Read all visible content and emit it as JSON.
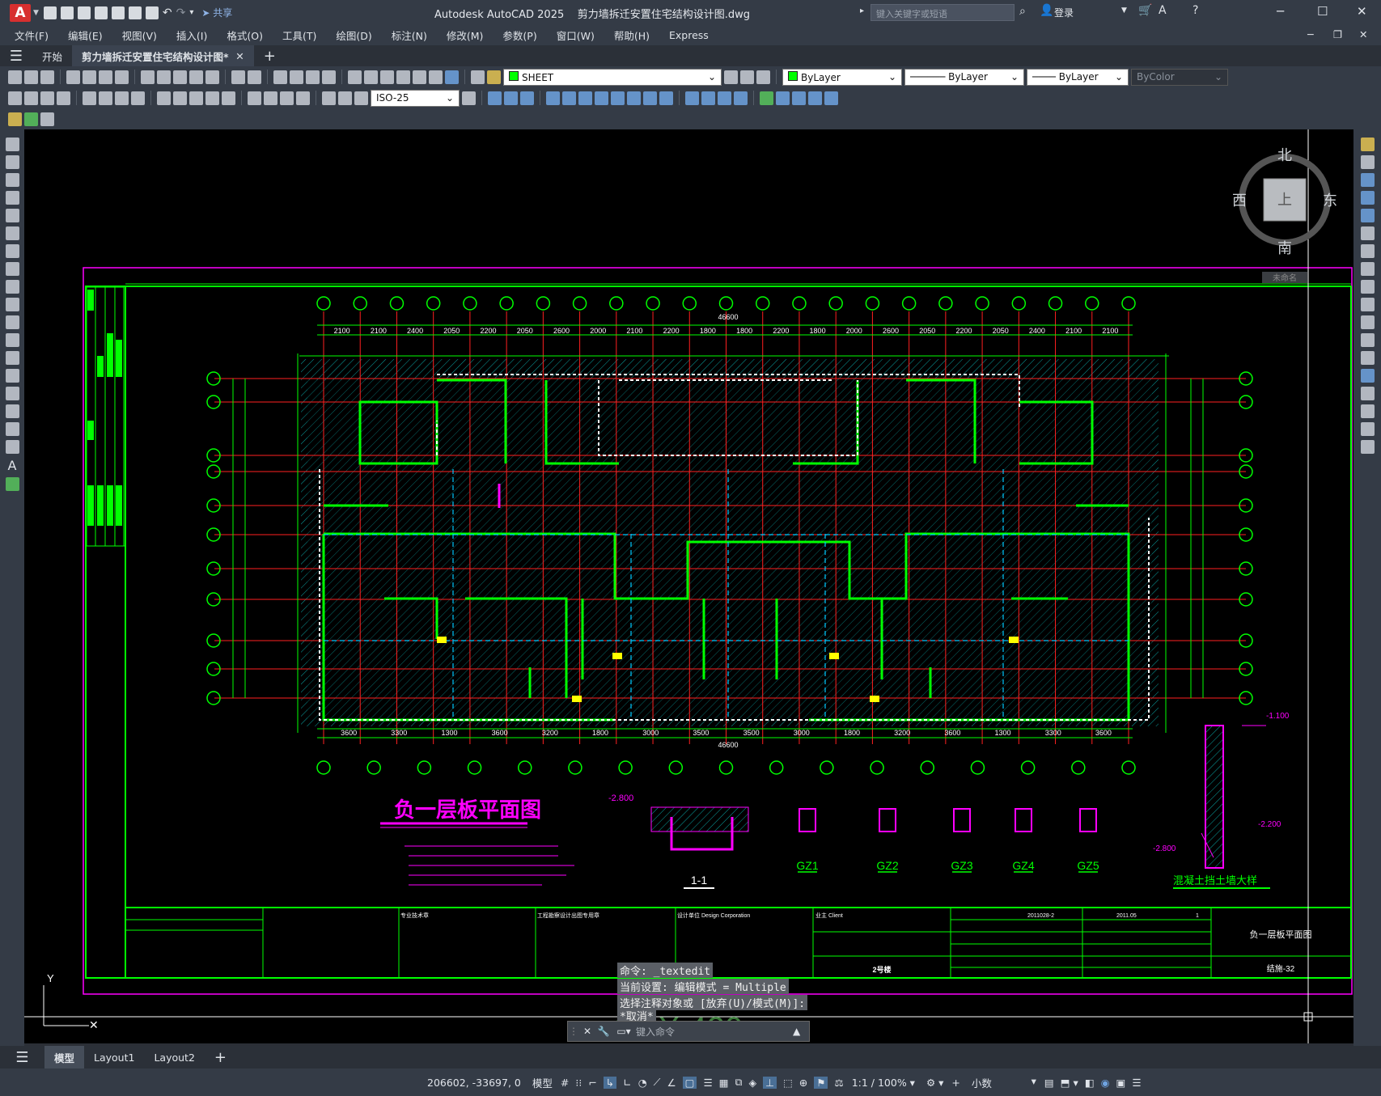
{
  "title": {
    "app": "Autodesk AutoCAD 2025",
    "file": "剪力墙拆迁安置住宅结构设计图.dwg",
    "share": "共享",
    "search_placeholder": "键入关键字或短语",
    "login": "登录",
    "app_badge": "A"
  },
  "menu": [
    "文件(F)",
    "编辑(E)",
    "视图(V)",
    "插入(I)",
    "格式(O)",
    "工具(T)",
    "绘图(D)",
    "标注(N)",
    "修改(M)",
    "参数(P)",
    "窗口(W)",
    "帮助(H)",
    "Express"
  ],
  "doc_tabs": {
    "start": "开始",
    "active": "剪力墙拆迁安置住宅结构设计图*"
  },
  "toolbar": {
    "layer": "SHEET",
    "color": "ByLayer",
    "linetype": "ByLayer",
    "lineweight": "ByLayer",
    "plotstyle": "ByColor",
    "dimstyle": "ISO-25"
  },
  "viewcube": {
    "north": "北",
    "south": "南",
    "east": "东",
    "west": "西",
    "top": "上",
    "wcs": "未命名"
  },
  "drawing": {
    "plan_title": "负一层板平面图",
    "section_label": "1-1",
    "gz": [
      "GZ1",
      "GZ2",
      "GZ3",
      "GZ4",
      "GZ5"
    ],
    "wall_detail": "混凝土挡土墙大样",
    "top_dims": [
      "2100",
      "2100",
      "2400",
      "2050",
      "2200",
      "2050",
      "2600",
      "2000",
      "2100",
      "2200",
      "1800",
      "1800",
      "2200",
      "1800",
      "2000",
      "2600",
      "2050",
      "2200",
      "2050",
      "2400",
      "2100",
      "2100"
    ],
    "bottom_dims": [
      "3600",
      "3300",
      "1300",
      "3600",
      "3200",
      "1800",
      "3000",
      "3500",
      "3500",
      "3000",
      "1800",
      "3200",
      "3600",
      "1300",
      "3300",
      "3600"
    ],
    "total_dim": "46600",
    "elev": "-2.800",
    "elev2": "-1.100",
    "elev3": "-2.200",
    "sheet_name": "负一层板平面图",
    "sheet_no": "结施-32",
    "building": "2号楼",
    "project_no": "2011028-2",
    "date": "2011.05",
    "revision": "1",
    "stamp_a": "专业技术章",
    "stamp_b": "工程勘察设计出图专用章",
    "company": "设计单位 Design Corporation",
    "client": "业主 Client"
  },
  "command": {
    "h1": "命令: _textedit",
    "h2": "当前设置: 编辑模式 = Multiple",
    "h3": "选择注释对象或 [放弃(U)/模式(M)]:",
    "h4": "*取消*",
    "placeholder": "键入命令"
  },
  "layout_tabs": [
    "模型",
    "Layout1",
    "Layout2"
  ],
  "status": {
    "coords": "206602, -33697, 0",
    "model": "模型",
    "scale": "1:1 / 100%",
    "units": "小数"
  },
  "colors": {
    "bg": "#000000",
    "green": "#00ff00",
    "magenta": "#ff00ff",
    "red": "#ff2020",
    "cyan": "#00ffff",
    "white": "#ffffff",
    "yellow": "#ffff00",
    "blue": "#3050ff"
  }
}
